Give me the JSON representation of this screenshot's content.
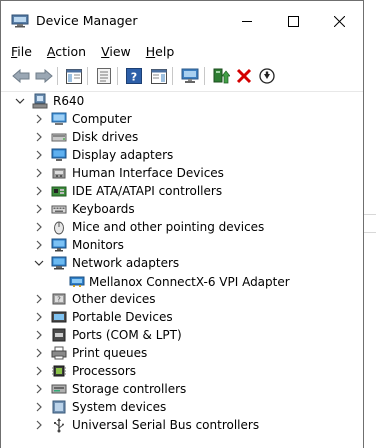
{
  "window": {
    "title": "Device Manager"
  },
  "menu": [
    {
      "key": "file",
      "label": "File",
      "u": "F",
      "rest": "ile"
    },
    {
      "key": "action",
      "label": "Action",
      "u": "A",
      "rest": "ction"
    },
    {
      "key": "view",
      "label": "View",
      "u": "V",
      "rest": "iew"
    },
    {
      "key": "help",
      "label": "Help",
      "u": "H",
      "rest": "elp"
    }
  ],
  "toolbar": [
    "back-arrow-icon",
    "forward-arrow-icon",
    "show-hide-console-tree-icon",
    "properties-icon",
    "help-icon",
    "action-pane-icon",
    "display-monitor-icon",
    "update-driver-icon",
    "uninstall-device-icon",
    "disable-device-icon"
  ],
  "tree": {
    "root": "R640",
    "categories": [
      {
        "label": "Computer",
        "icon": "computer-icon",
        "expanded": false
      },
      {
        "label": "Disk drives",
        "icon": "disk-drive-icon",
        "expanded": false
      },
      {
        "label": "Display adapters",
        "icon": "display-adapter-icon",
        "expanded": false
      },
      {
        "label": "Human Interface Devices",
        "icon": "hid-icon",
        "expanded": false
      },
      {
        "label": "IDE ATA/ATAPI controllers",
        "icon": "ide-controller-icon",
        "expanded": false
      },
      {
        "label": "Keyboards",
        "icon": "keyboard-icon",
        "expanded": false
      },
      {
        "label": "Mice and other pointing devices",
        "icon": "mouse-icon",
        "expanded": false
      },
      {
        "label": "Monitors",
        "icon": "monitor-icon",
        "expanded": false
      },
      {
        "label": "Network adapters",
        "icon": "network-adapter-icon",
        "expanded": true,
        "children": [
          {
            "label": "Mellanox ConnectX-6 VPI Adapter",
            "icon": "network-card-icon"
          }
        ]
      },
      {
        "label": "Other devices",
        "icon": "other-devices-icon",
        "expanded": false
      },
      {
        "label": "Portable Devices",
        "icon": "portable-device-icon",
        "expanded": false
      },
      {
        "label": "Ports (COM & LPT)",
        "icon": "port-icon",
        "expanded": false
      },
      {
        "label": "Print queues",
        "icon": "printer-icon",
        "expanded": false
      },
      {
        "label": "Processors",
        "icon": "processor-icon",
        "expanded": false
      },
      {
        "label": "Storage controllers",
        "icon": "storage-controller-icon",
        "expanded": false
      },
      {
        "label": "System devices",
        "icon": "system-devices-icon",
        "expanded": false
      },
      {
        "label": "Universal Serial Bus controllers",
        "icon": "usb-icon",
        "expanded": false
      }
    ]
  }
}
